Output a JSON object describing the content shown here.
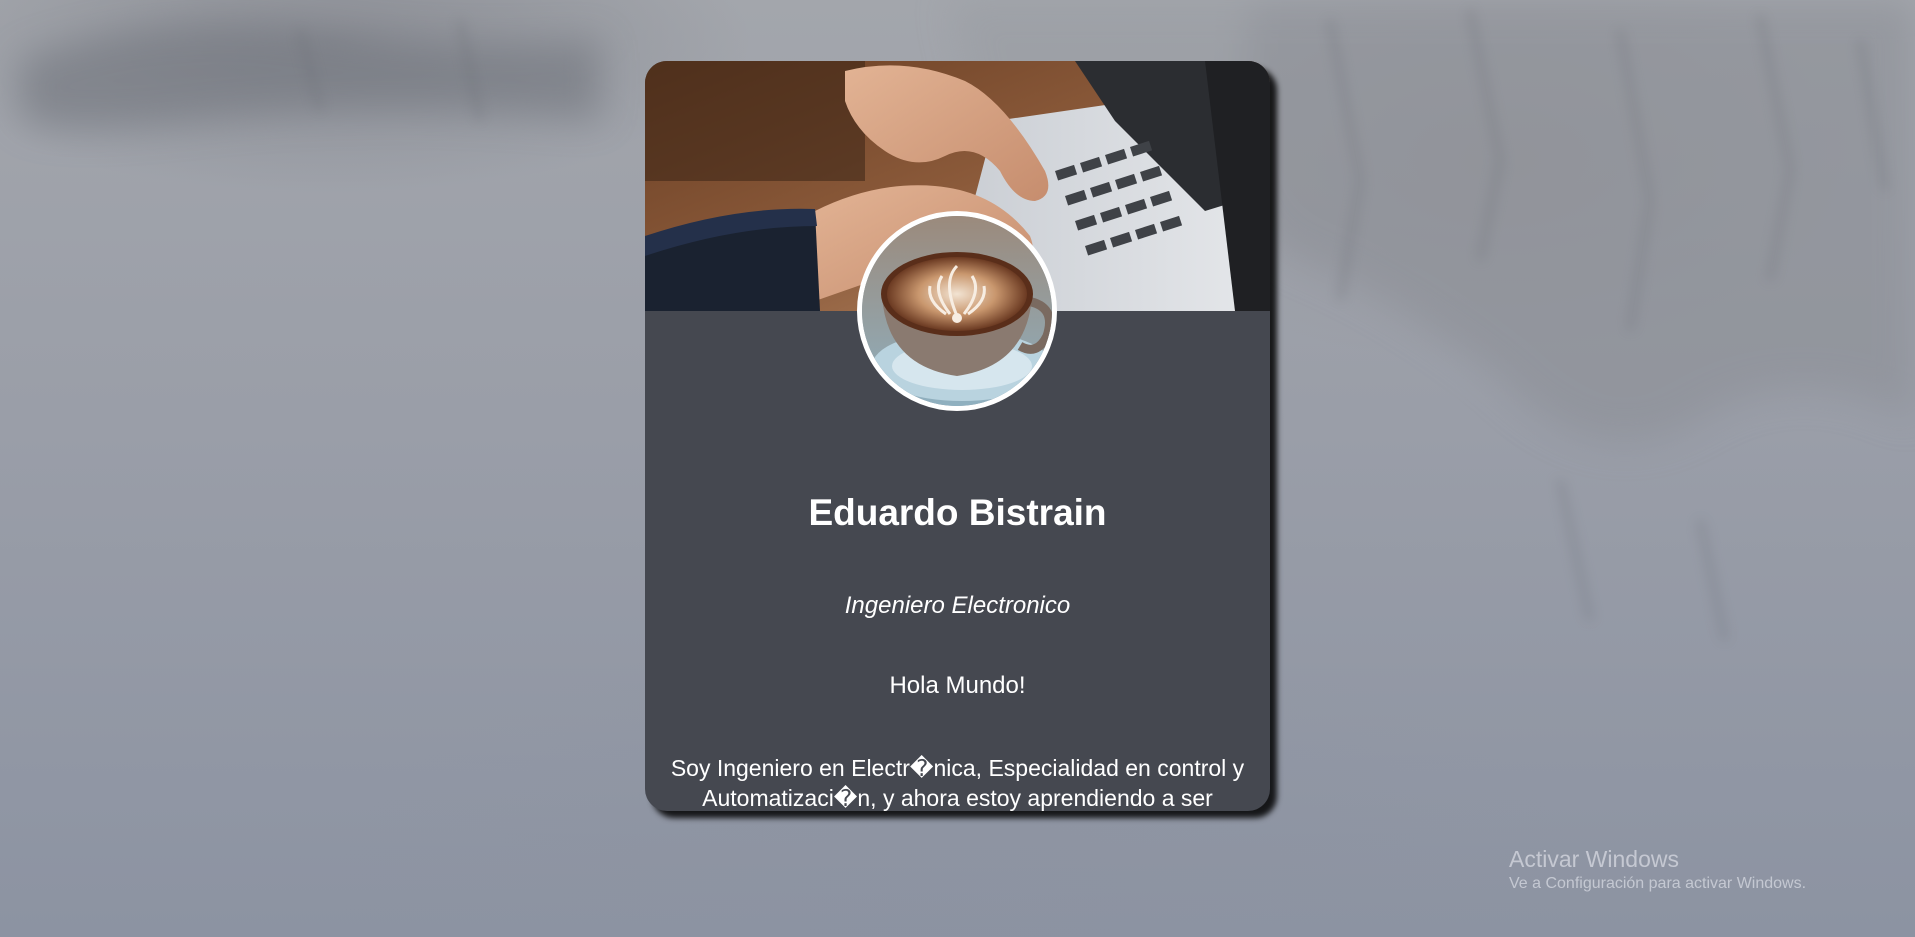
{
  "profile": {
    "name": "Eduardo Bistrain",
    "role": "Ingeniero Electronico",
    "greeting": "Hola Mundo!",
    "bio": "Soy Ingeniero en Electr�nica, Especialidad en control y Automatizaci�n, y ahora estoy aprendiendo a ser Desarrollador Wed!"
  },
  "images": {
    "cover": "laptop-typing-photo",
    "avatar": "latte-coffee-cup-photo"
  },
  "watermark": {
    "title": "Activar Windows",
    "subtitle": "Ve a Configuración para activar Windows."
  },
  "colors": {
    "card_background": "#454850",
    "text": "#ffffff",
    "avatar_border": "#ffffff"
  }
}
